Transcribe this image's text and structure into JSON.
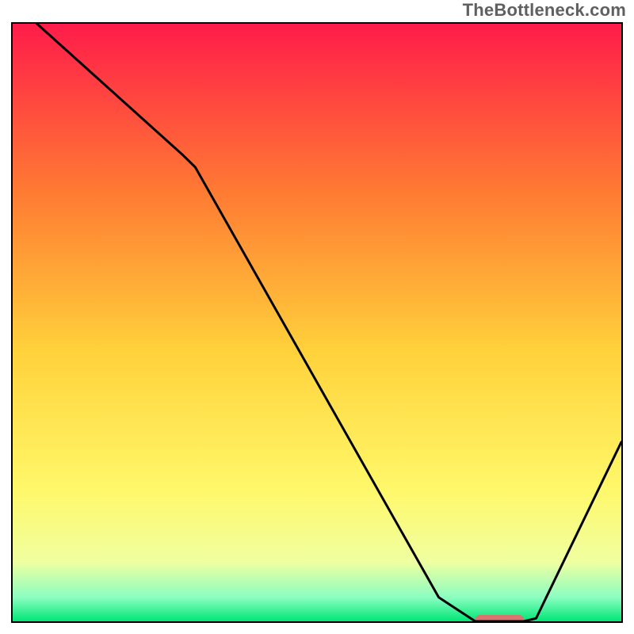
{
  "watermark": "TheBottleneck.com",
  "colors": {
    "border": "#000000",
    "curve": "#000000",
    "marker": "#d9746f",
    "gradient_top": "#ff1c4a",
    "gradient_mid1": "#ff7a33",
    "gradient_mid2": "#ffd23b",
    "gradient_mid3": "#fff86a",
    "gradient_mid4": "#f0ffa0",
    "gradient_bottom_hi": "#8bfec1",
    "gradient_bottom": "#00e676"
  },
  "chart_data": {
    "type": "line",
    "title": "",
    "xlabel": "",
    "ylabel": "",
    "xlim": [
      0,
      100
    ],
    "ylim": [
      0,
      100
    ],
    "x": [
      0,
      4,
      28,
      30,
      70,
      76,
      84,
      86,
      100
    ],
    "values": [
      105,
      100,
      78,
      76,
      4,
      0,
      0,
      0.5,
      30
    ],
    "marker": {
      "x_start": 76,
      "x_end": 84,
      "y": 0
    }
  }
}
